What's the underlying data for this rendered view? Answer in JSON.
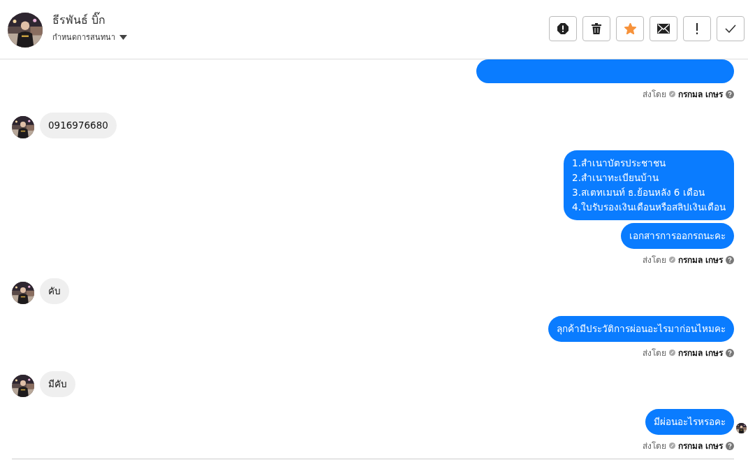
{
  "header": {
    "contact_name": "ธีรพันธ์ บิ๊ก",
    "conversation_menu": "กำหนดการสนทนา",
    "starred": true
  },
  "messages": [
    {
      "kind": "outgoing_cut",
      "sent_by_label": "ส่งโดย",
      "agent": "กรกมล เกษร"
    },
    {
      "kind": "incoming",
      "bubbles": [
        "0916976680"
      ]
    },
    {
      "kind": "outgoing",
      "bubbles": [
        "1.สำเนาบัตรประชาชน\n2.สำเนาทะเบียนบ้าน\n3.สเตทเมนท์ ธ.ย้อนหลัง 6 เดือน\n4.ใบรับรองเงินเดือนหรือสลิปเงินเดือน",
        "เอกสารการออกรถนะคะ"
      ],
      "sent_by_label": "ส่งโดย",
      "agent": "กรกมล เกษร",
      "seen": false
    },
    {
      "kind": "incoming",
      "bubbles": [
        "คับ"
      ]
    },
    {
      "kind": "outgoing",
      "bubbles": [
        "ลุกค้ามีประวัติการผ่อนอะไรมาก่อนไหมคะ"
      ],
      "sent_by_label": "ส่งโดย",
      "agent": "กรกมล เกษร",
      "seen": false
    },
    {
      "kind": "incoming",
      "bubbles": [
        "มีคับ"
      ]
    },
    {
      "kind": "outgoing",
      "bubbles": [
        "มีผ่อนอะไรหรอคะ"
      ],
      "sent_by_label": "ส่งโดย",
      "agent": "กรกมล เกษร",
      "seen": true
    }
  ]
}
